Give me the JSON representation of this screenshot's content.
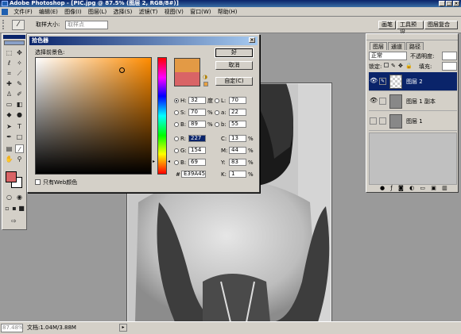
{
  "app": {
    "title": "Adobe Photoshop - [PIC.jpg @ 87.5% (图层 2, RGB/8#)]",
    "window_buttons": [
      "_",
      "□",
      "×"
    ]
  },
  "menu": [
    "文件(F)",
    "编辑(E)",
    "图像(I)",
    "图层(L)",
    "选择(S)",
    "滤镜(T)",
    "视图(V)",
    "窗口(W)",
    "帮助(H)"
  ],
  "options_bar": {
    "sample_size_label": "取样大小:",
    "sample_size_value": "取样点",
    "tabs": [
      "画笔",
      "工具预设",
      "图层复合"
    ]
  },
  "color_picker": {
    "title": "拾色器",
    "prompt": "选择前景色:",
    "ok": "好",
    "cancel": "取消",
    "custom": "自定(C)",
    "web_only": "只有Web颜色",
    "new_color": "#e39a45",
    "old_color": "#d96466",
    "hsb": {
      "H": "32",
      "S": "70",
      "B": "89"
    },
    "rgb": {
      "R": "227",
      "G": "154",
      "B": "69"
    },
    "lab": {
      "L": "70",
      "a": "22",
      "b": "55"
    },
    "cmyk": {
      "C": "13",
      "M": "44",
      "Y": "83",
      "K": "1"
    },
    "hex": "E39A45",
    "units": {
      "deg": "度",
      "pct": "%"
    }
  },
  "layers_panel": {
    "tabs": [
      "图层",
      "通道",
      "路径"
    ],
    "blend_mode": "正常",
    "opacity_label": "不透明度:",
    "lock_label": "锁定:",
    "fill_label": "填充:",
    "layers": [
      {
        "name": "图层 2",
        "selected": true
      },
      {
        "name": "图层 1 副本",
        "selected": false
      },
      {
        "name": "图层 1",
        "selected": false
      }
    ]
  },
  "status": {
    "zoom": "87.48%",
    "doc_info": "文档:1.04M/3.88M"
  },
  "toolbox": {
    "foreground_color": "#d96466",
    "background_color": "#ffffff"
  }
}
